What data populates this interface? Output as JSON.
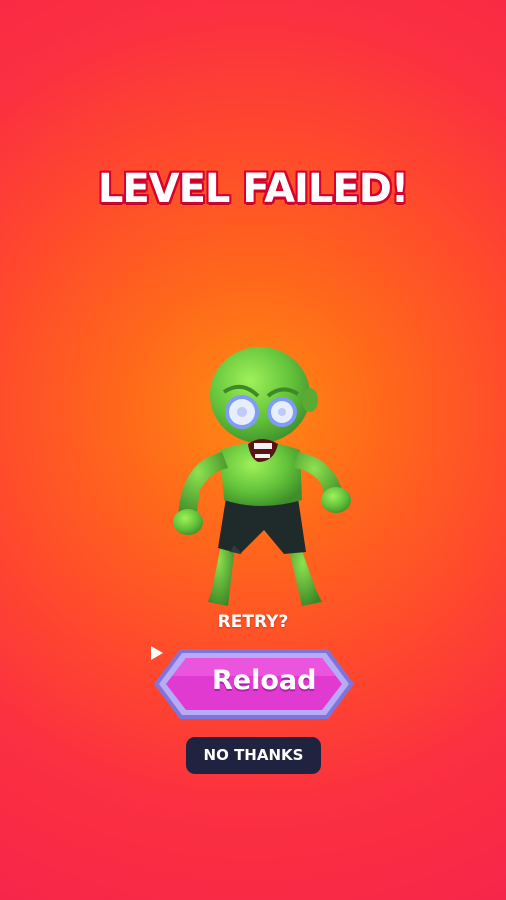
{
  "screen": {
    "title": "LEVEL FAILED!",
    "retry_prompt": "RETRY?",
    "reload_button_label": "Reload",
    "no_thanks_label": "NO THANKS"
  },
  "icons": {
    "reload_button": "play-icon",
    "character": "zombie-character"
  },
  "colors": {
    "title_outline": "#d8002e",
    "reload_button": "#e53ad8",
    "reload_border": "#9c8cf2",
    "no_thanks_background": "#20233f",
    "background_center": "#ff8a12",
    "background_edge": "#f6264a"
  }
}
